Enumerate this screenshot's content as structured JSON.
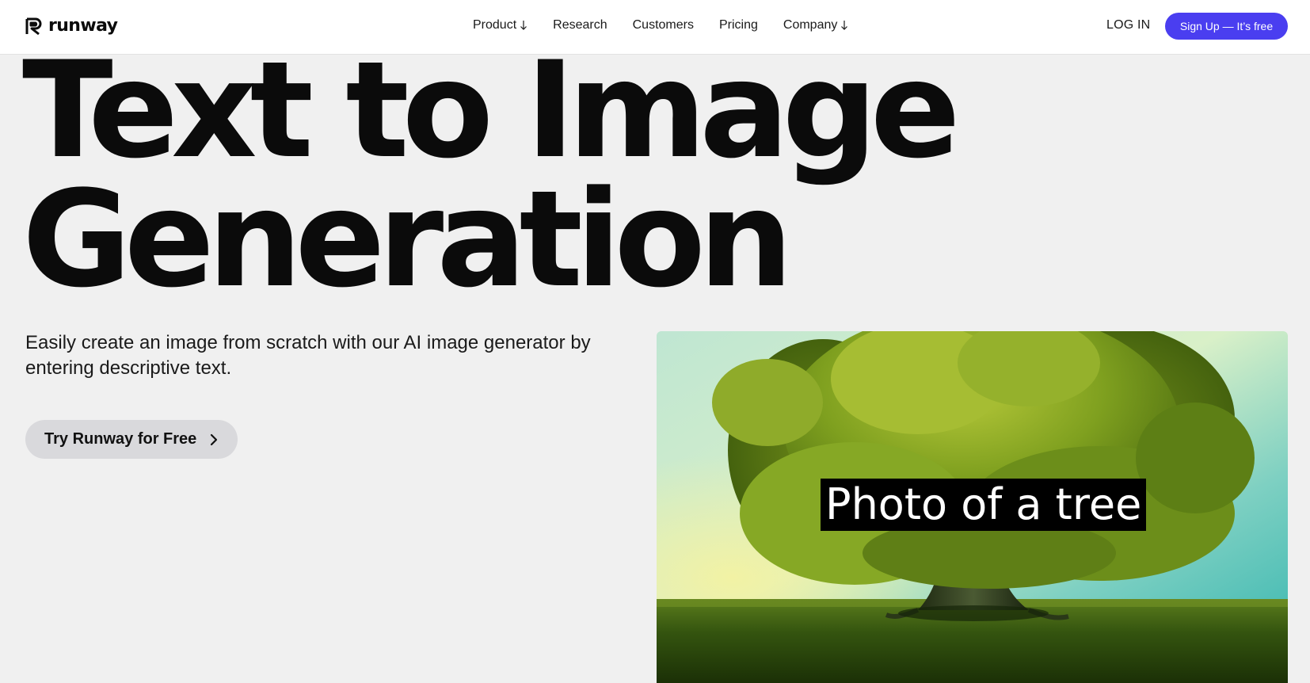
{
  "header": {
    "logo_text": "runway",
    "logo_icon": "runway-logo-icon",
    "nav": [
      {
        "label": "Product",
        "has_dropdown": true
      },
      {
        "label": "Research",
        "has_dropdown": false
      },
      {
        "label": "Customers",
        "has_dropdown": false
      },
      {
        "label": "Pricing",
        "has_dropdown": false
      },
      {
        "label": "Company",
        "has_dropdown": true
      }
    ],
    "login_label": "LOG IN",
    "signup_label": "Sign Up — It’s free"
  },
  "hero": {
    "title_line1": "Text to Image",
    "title_line2": "Generation",
    "description": "Easily create an image from scratch with our AI image generator by entering descriptive text.",
    "cta_label": "Try Runway for Free"
  },
  "media": {
    "prompt_text": "Photo of a tree",
    "image_subject": "generated tree image"
  },
  "colors": {
    "accent": "#4a3ef0",
    "background": "#f0f0f0",
    "cta_background": "#d9d9dc"
  }
}
